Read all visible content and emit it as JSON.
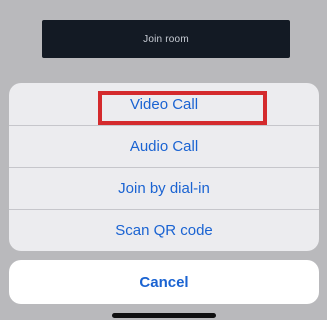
{
  "background_screen": {
    "join_room_label": "Join room"
  },
  "action_sheet": {
    "items": [
      {
        "label": "Video Call"
      },
      {
        "label": "Audio Call"
      },
      {
        "label": "Join by dial-in"
      },
      {
        "label": "Scan QR code"
      }
    ],
    "highlighted_item": "Video Call",
    "cancel_label": "Cancel"
  },
  "colors": {
    "action_text": "#1a63d2",
    "highlight_border": "#d42a2d",
    "join_bar": "#131a24",
    "sheet_background": "#ececef",
    "dimmed_overlay": "#b9b9bc"
  }
}
